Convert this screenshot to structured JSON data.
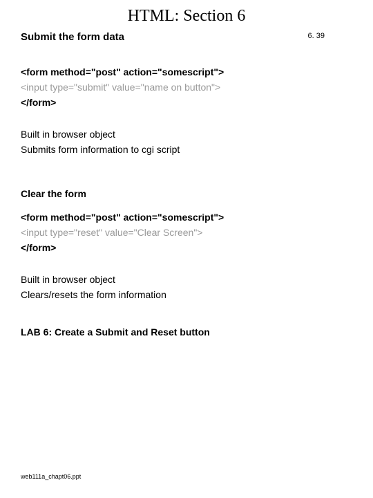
{
  "title": "HTML: Section 6",
  "pagenum": "6. 39",
  "section1": {
    "heading": "Submit the form data",
    "code1": "<form method=\"post\" action=\"somescript\">",
    "code2": "<input type=\"submit\" value=\"name on button\">",
    "code3": "</form>",
    "desc1": "Built in browser object",
    "desc2": "Submits form information to cgi script"
  },
  "section2": {
    "heading": "Clear the form",
    "code1": "<form method=\"post\" action=\"somescript\">",
    "code2": "<input type=\"reset\" value=\"Clear Screen\">",
    "code3": "</form>",
    "desc1": "Built in browser object",
    "desc2": "Clears/resets the form information"
  },
  "lab": "LAB 6: Create a Submit and Reset button",
  "footer": "web111a_chapt06.ppt"
}
